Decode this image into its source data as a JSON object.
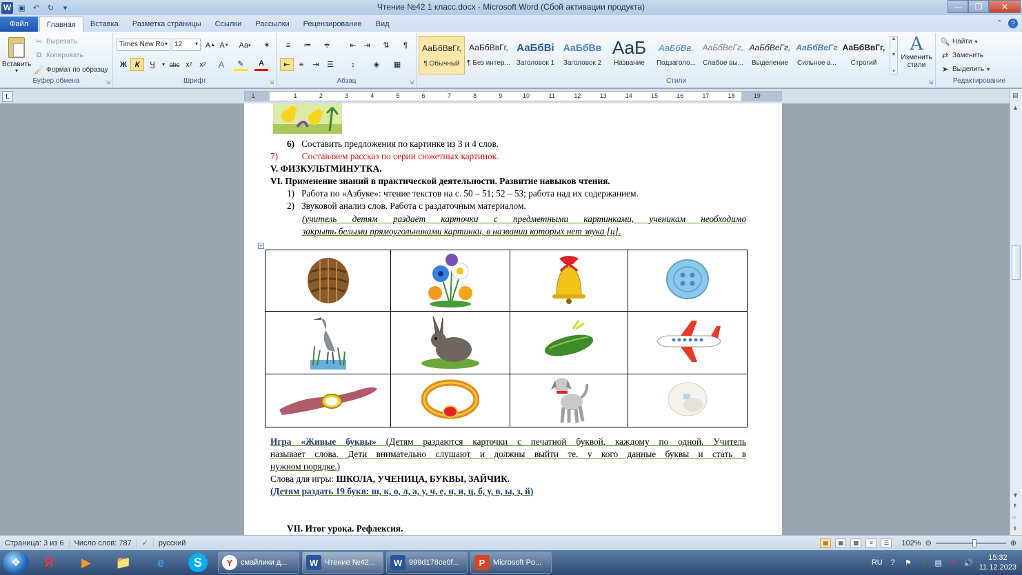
{
  "window": {
    "title": "Чтение №42 1 класс.docx - Microsoft Word (Сбой активации продукта)"
  },
  "tabs": {
    "file": "Файл",
    "items": [
      "Главная",
      "Вставка",
      "Разметка страницы",
      "Ссылки",
      "Рассылки",
      "Рецензирование",
      "Вид"
    ],
    "active": "Главная"
  },
  "ribbon": {
    "clipboard": {
      "paste": "Вставить",
      "cut": "Вырезать",
      "copy": "Копировать",
      "format_painter": "Формат по образцу",
      "label": "Буфер обмена"
    },
    "font": {
      "name": "Times New Ro",
      "size": "12",
      "label": "Шрифт"
    },
    "paragraph": {
      "label": "Абзац"
    },
    "styles": {
      "label": "Стили",
      "change_styles": "Изменить стили",
      "items": [
        {
          "sample": "АаБбВвГг,",
          "name": "¶ Обычный"
        },
        {
          "sample": "АаБбВвГг,",
          "name": "¶ Без интер..."
        },
        {
          "sample": "АаБбВі",
          "name": "Заголовок 1"
        },
        {
          "sample": "АаБбВв",
          "name": "Заголовок 2"
        },
        {
          "sample": "АаБ",
          "name": "Название"
        },
        {
          "sample": "АаБбВв.",
          "name": "Подзаголо..."
        },
        {
          "sample": "АаБбВеГг,",
          "name": "Слабое вы..."
        },
        {
          "sample": "АаБбВеГг,",
          "name": "Выделение"
        },
        {
          "sample": "АаБбВеГг",
          "name": "Сильное в..."
        },
        {
          "sample": "АаБбВвГг,",
          "name": "Строгий"
        }
      ]
    },
    "editing": {
      "label": "Редактирование",
      "find": "Найти",
      "replace": "Заменить",
      "select": "Выделить"
    }
  },
  "ruler": {
    "numbers": [
      "1",
      "1",
      "2",
      "3",
      "4",
      "5",
      "6",
      "7",
      "8",
      "9",
      "10",
      "11",
      "12",
      "13",
      "14",
      "15",
      "16",
      "17",
      "18",
      "19"
    ]
  },
  "document": {
    "item6_num": "6)",
    "item6_text": "Составить предложения по картинке из 3 и 4 слов.",
    "item7_num": "7)",
    "item7_text": "Составляем рассказ по серии сюжетных картинок.",
    "section5": "V. ФИЗКУЛЬТМИНУТКА.",
    "section6": "VI. Применение знаний в практической деятельности. Развитие навыков чтения.",
    "sub1_num": "1)",
    "sub1_text": "Работа по «Азбуке»: чтение текстов на с. 50 – 51; 52 – 53; работа над их содержанием.",
    "sub2_num": "2)",
    "sub2_text": "Звуковой анализ слов. Работа с раздаточным материалом.",
    "note_line1": "(учитель детям раздаёт карточки с предметными картинками, ученикам необходимо",
    "note_line2": "закрыть белыми прямоугольниками картинки, в названии которых нет звука [ц].",
    "game_title": "Игра «Живые буквы»",
    "game_line1_rest": " (Детям раздаются карточки с печатной буквой, каждому по одной. Учитель",
    "game_line2": "называет слова. Дети внимательно слушают и должны выйти те, у кого данные буквы и стать в",
    "game_line3": "нужном порядке.)",
    "words_label": "Слова для игры: ",
    "words_value": "ШКОЛА, УЧЕНИЦА, БУКВЫ, ЗАЙЧИК.",
    "letters": "(Детям раздать  19 букв: ш, к, о, л, а,  у, ч, е, н, и, ц, б, у, в, ы,  з, й)",
    "section7": "VII.  Итог урока. Рефлексия."
  },
  "status": {
    "page": "Страница: 3 из 6",
    "words": "Число слов: 787",
    "language": "русский",
    "zoom": "102%",
    "zoom_fraction": 0.55
  },
  "taskbar": {
    "tasks": [
      {
        "label": "смайлики д...",
        "icon": "Y"
      },
      {
        "label": "Чтение №42...",
        "icon": "W"
      },
      {
        "label": "999d178ce0f...",
        "icon": "W"
      },
      {
        "label": "Microsoft Po...",
        "icon": "P"
      }
    ],
    "lang": "RU",
    "time": "15:32",
    "date": "11.12.2023"
  },
  "colors": {
    "accent": "#2a5699",
    "red_text": "#e01010",
    "navy_text": "#1f3a7a"
  }
}
